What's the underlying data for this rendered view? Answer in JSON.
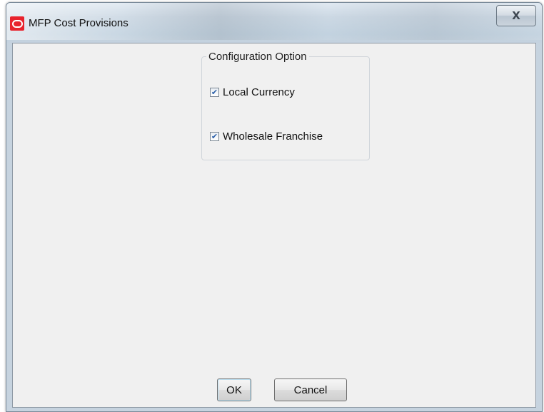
{
  "window": {
    "title": "MFP Cost Provisions",
    "app_icon": "oracle-logo-icon",
    "close_glyph": "X"
  },
  "config_group": {
    "legend": "Configuration Option",
    "options": [
      {
        "label": "Local Currency",
        "checked": true
      },
      {
        "label": "Wholesale Franchise",
        "checked": true
      }
    ]
  },
  "buttons": {
    "ok_label": "OK",
    "cancel_label": "Cancel"
  },
  "colors": {
    "app_icon_red": "#e8232d",
    "check_mark_blue": "#2a5ea8"
  }
}
